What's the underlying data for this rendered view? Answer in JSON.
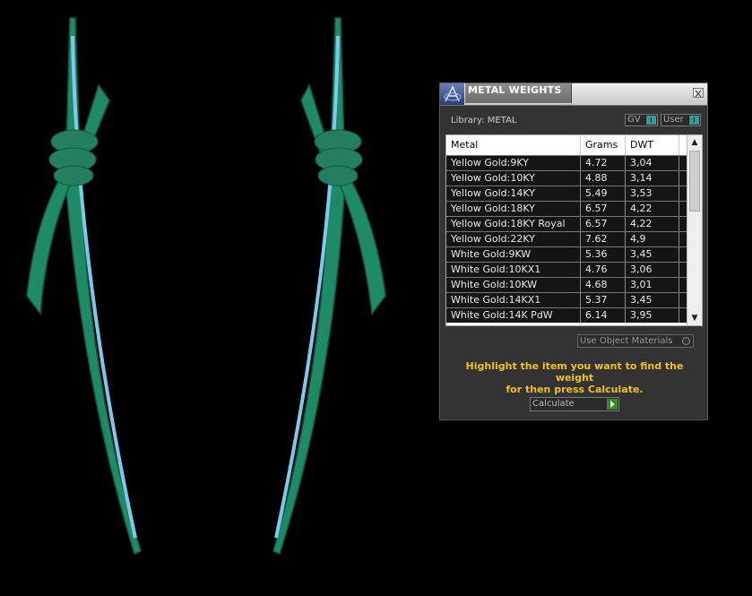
{
  "panel": {
    "title": "METAL WEIGHTS",
    "library_label": "Library: METAL",
    "toggles": {
      "gv": "GV",
      "user": "User"
    },
    "table": {
      "headers": {
        "metal": "Metal",
        "grams": "Grams",
        "dwt": "DWT"
      },
      "rows": [
        {
          "metal": "Yellow Gold:9KY",
          "grams": "4.72",
          "dwt": "3,04"
        },
        {
          "metal": "Yellow Gold:10KY",
          "grams": "4.88",
          "dwt": "3,14"
        },
        {
          "metal": "Yellow Gold:14KY",
          "grams": "5.49",
          "dwt": "3,53"
        },
        {
          "metal": "Yellow Gold:18KY",
          "grams": "6.57",
          "dwt": "4,22"
        },
        {
          "metal": "Yellow Gold:18KY Royal",
          "grams": "6.57",
          "dwt": "4,22"
        },
        {
          "metal": "Yellow Gold:22KY",
          "grams": "7.62",
          "dwt": "4,9"
        },
        {
          "metal": "White Gold:9KW",
          "grams": "5.36",
          "dwt": "3,45"
        },
        {
          "metal": "White Gold:10KX1",
          "grams": "4.76",
          "dwt": "3,06"
        },
        {
          "metal": "White Gold:10KW",
          "grams": "4.68",
          "dwt": "3,01"
        },
        {
          "metal": "White Gold:14KX1",
          "grams": "5.37",
          "dwt": "3,45"
        },
        {
          "metal": "White Gold:14K PdW",
          "grams": "6.14",
          "dwt": "3,95"
        }
      ]
    },
    "use_object_materials": "Use Object Materials",
    "hint_line1": "Highlight the item you want to find the weight",
    "hint_line2": "for then press Calculate.",
    "calculate": "Calculate"
  },
  "colors": {
    "model_green": "#1f8a66",
    "model_inner": "#7ec8ee",
    "hint": "#f0c020"
  }
}
